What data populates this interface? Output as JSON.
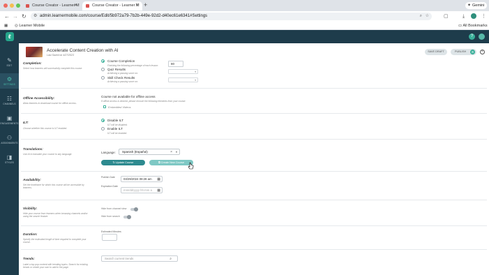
{
  "browser": {
    "tabs": [
      {
        "title": "Course Creator - Learner M"
      },
      {
        "title": "Course Creator - Learner M"
      }
    ],
    "new_tab": "+",
    "gemini_label": "Gemini",
    "url": "admin.learnermobile.com/course/Edit/5b972a79-7b2b-449e-92d2-d40ec61e6341#Settings",
    "bookmark_site": "Learner Mobile",
    "all_bookmarks": "All Bookmarks"
  },
  "colors": {
    "header_bg": "#1e3c4b",
    "accent": "#3ab09a",
    "button_teal": "#2d8a8f"
  },
  "sidebar": {
    "items": [
      {
        "label": "EDIT",
        "icon": "pencil-icon"
      },
      {
        "label": "SETTINGS",
        "icon": "gear-icon"
      },
      {
        "label": "CHANNELS",
        "icon": "channels-icon"
      },
      {
        "label": "ENGAGEMENTS",
        "icon": "engagements-icon"
      },
      {
        "label": "ASSIGNMENTS",
        "icon": "assignments-icon"
      },
      {
        "label": "STYLES",
        "icon": "styles-icon"
      }
    ]
  },
  "course": {
    "title": "Accelerate Content Creation with AI",
    "last_saved": "Last Saved on 4/27/2023",
    "save_draft": "SAVE DRAFT",
    "publish": "PUBLISH"
  },
  "completion": {
    "title": "Completion:",
    "desc": "Select how learners will successfully complete this course.",
    "options": [
      {
        "label": "Course Completion",
        "sub": "Finishing the following percentage of each lesson:",
        "selected": true,
        "value": "80"
      },
      {
        "label": "Quiz Results",
        "sub": "Achieving a passing score on:",
        "selected": false
      },
      {
        "label": "Skill Check Results",
        "sub": "Achieving a passing score on:",
        "selected": false
      }
    ]
  },
  "offline": {
    "title": "Offline Accessibility:",
    "desc": "Allow learners to download course for offline access.",
    "status": "Course not available for offline access",
    "note": "If offline access is desired, please remove the following elements from your course:",
    "item": "Embedded Videos"
  },
  "ilt": {
    "title": "ILT:",
    "desc": "Choose whether this course is ILT enabled.",
    "options": [
      {
        "label": "Disable ILT",
        "sub": "ILT will be disabled.",
        "selected": true
      },
      {
        "label": "Enable ILT",
        "sub": "ILT will be enabled.",
        "selected": false
      }
    ]
  },
  "translations": {
    "title": "Translations:",
    "desc": "Use AI to translate your course to any language.",
    "language_label": "Language:",
    "language_value": "Spanish (Español)",
    "update_button": "Update Course",
    "create_button": "Create New Course"
  },
  "availability": {
    "title": "Availability:",
    "desc": "Set the timeframe for which this course will be accessible by learners.",
    "published_label": "Publish Date",
    "published_value": "03/29/2024 08:28 am",
    "expiration_label": "Expiration Date",
    "expiration_placeholder": "mm/dd/yyyy hh:mm a"
  },
  "visibility": {
    "title": "Visibility:",
    "desc": "Hide your course from learners when browsing channels and/or using the search feature.",
    "hide_channel": "Hide from channel view",
    "hide_search": "Hide from search"
  },
  "duration": {
    "title": "Duration:",
    "desc": "Specify the estimated length of time required to complete your course.",
    "minutes_label": "Estimated Minutes"
  },
  "trends": {
    "title": "Trends:",
    "desc": "Label a top pop content with trending topics. Search for existing trends or create your own to add to the page.",
    "search_placeholder": "Search current trends"
  }
}
